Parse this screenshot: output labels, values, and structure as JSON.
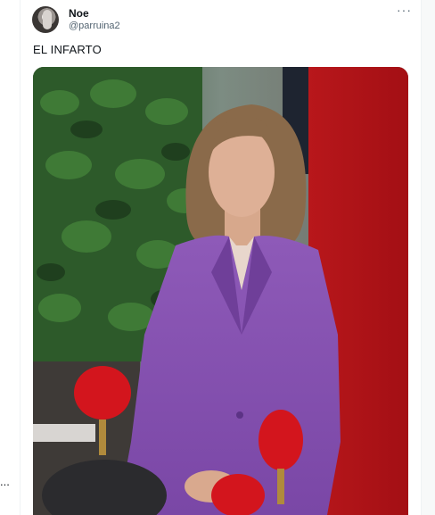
{
  "tweet": {
    "author_name": "Noe",
    "author_handle": "@parruina2",
    "more_label": "···",
    "text": "EL INFARTO",
    "media": {
      "description_icon": "photo-icon"
    }
  },
  "left_column": {
    "dots": "..."
  }
}
